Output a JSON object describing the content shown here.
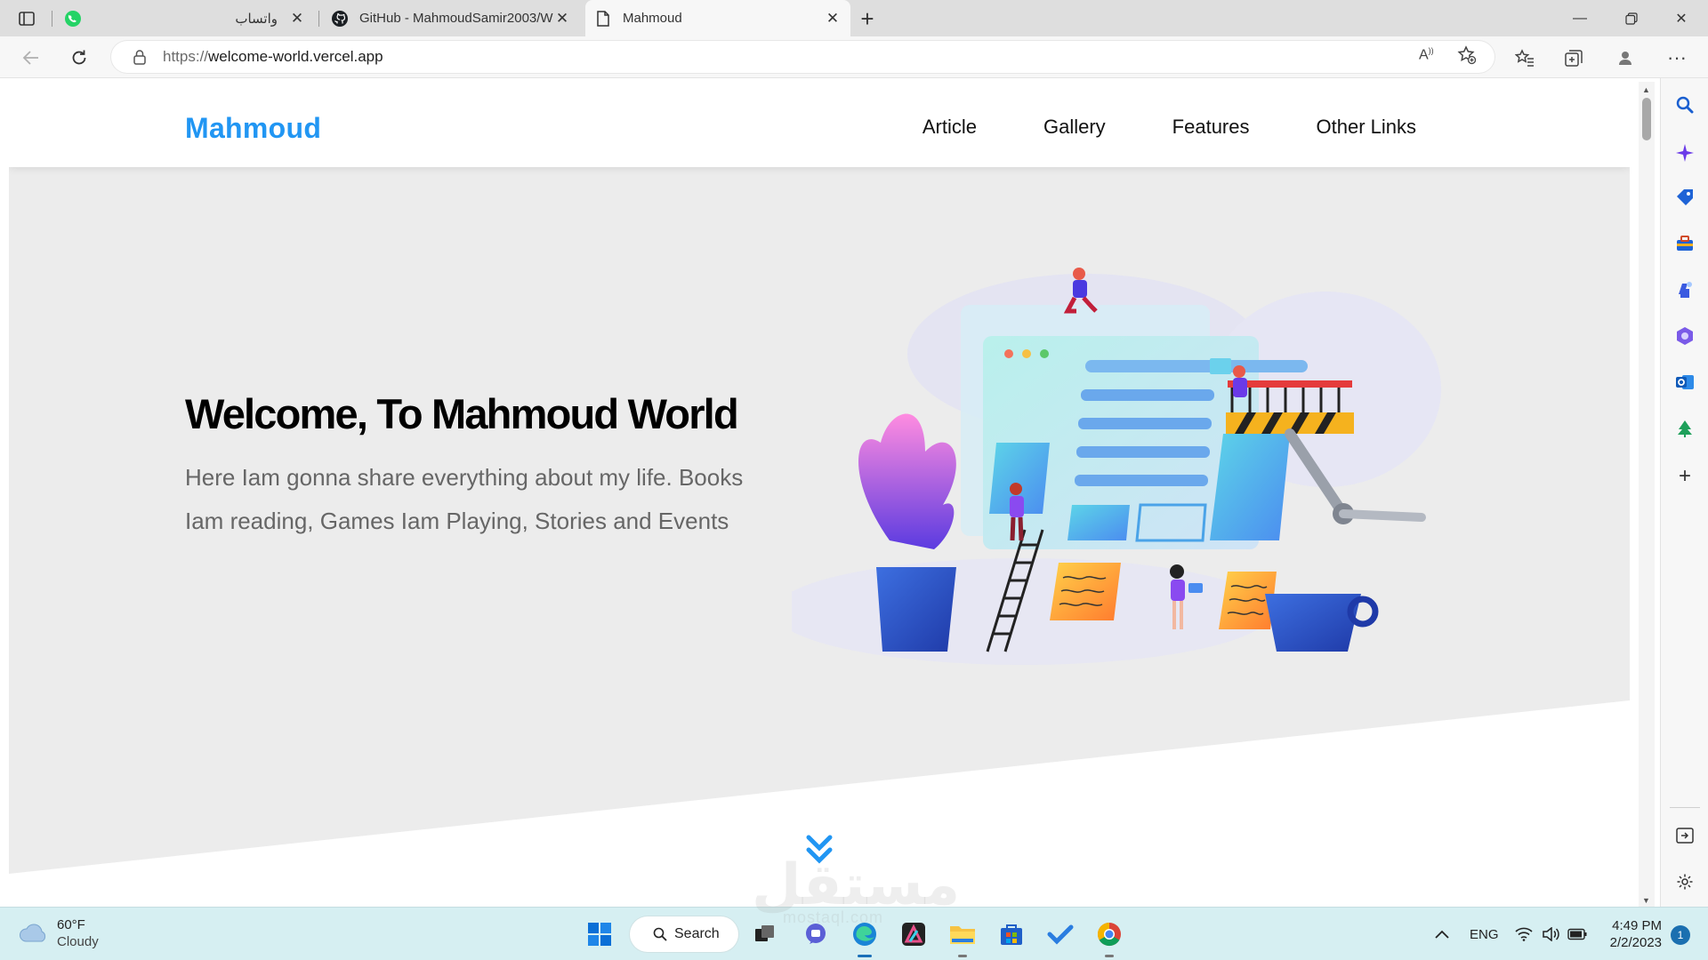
{
  "tabs": [
    {
      "title": "واتساب",
      "favicon": "whatsapp-icon",
      "active": false
    },
    {
      "title": "GitHub - MahmoudSamir2003/W",
      "favicon": "github-icon",
      "active": false
    },
    {
      "title": "Mahmoud",
      "favicon": "page-icon",
      "active": true
    }
  ],
  "address": {
    "protocol": "https://",
    "host": "welcome-world.vercel.app"
  },
  "site": {
    "logo": "Mahmoud",
    "nav": [
      "Article",
      "Gallery",
      "Features",
      "Other Links"
    ],
    "hero_title": "Welcome, To Mahmoud World",
    "hero_description": "Here Iam gonna share everything about my life. Books Iam reading, Games Iam Playing, Stories and Events"
  },
  "taskbar": {
    "weather_temp": "60°F",
    "weather_condition": "Cloudy",
    "search_label": "Search",
    "language": "ENG",
    "time": "4:49 PM",
    "date": "2/2/2023",
    "notification_count": "1"
  },
  "watermark": {
    "text": "مستقل",
    "sub": "mostaql.com"
  },
  "colors": {
    "accent": "#2196f3",
    "hero_bg": "#ececec",
    "taskbar_bg": "#d6eff2"
  }
}
